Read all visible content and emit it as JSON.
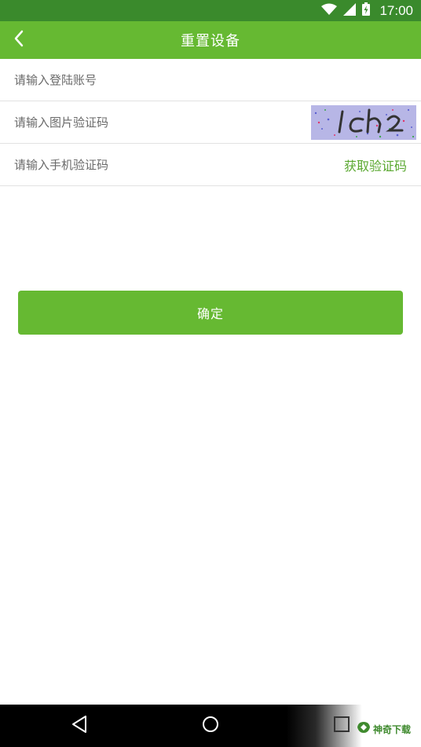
{
  "status_bar": {
    "time": "17:00",
    "icons": [
      "wifi-icon",
      "signal-icon",
      "battery-icon"
    ]
  },
  "header": {
    "title": "重置设备",
    "back_icon": "chevron-left-icon"
  },
  "form": {
    "account_placeholder": "请输入登陆账号",
    "image_code_placeholder": "请输入图片验证码",
    "captcha_text": "lch2",
    "sms_code_placeholder": "请输入手机验证码",
    "get_code_label": "获取验证码"
  },
  "actions": {
    "confirm_label": "确定"
  },
  "watermark": {
    "text": "神奇下载"
  },
  "colors": {
    "status_bar": "#3a8a2c",
    "primary": "#66b932",
    "link": "#5aa830",
    "captcha_bg": "#b7b6e6"
  }
}
